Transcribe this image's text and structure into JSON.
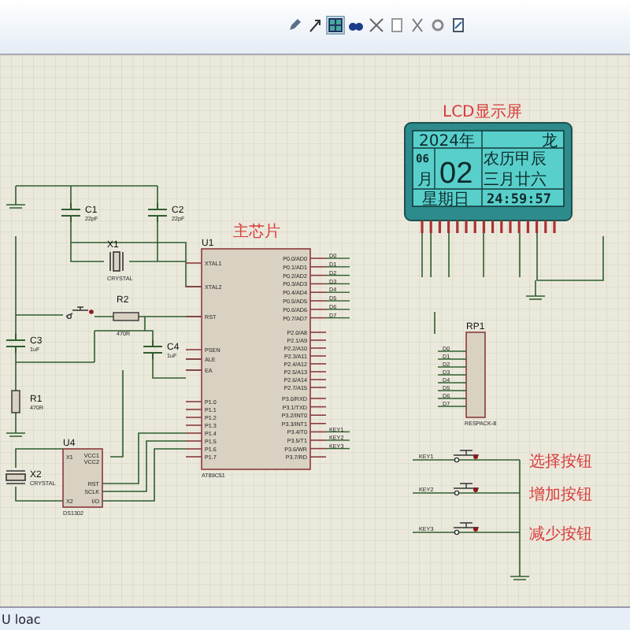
{
  "schematic": {
    "lcd": {
      "title": "LCD显示屏",
      "year": "2024年",
      "zodiac": "龙",
      "month_num": "06",
      "month_char": "月",
      "day": "02",
      "lunar_year": "农历甲辰",
      "lunar_date": "三月廿六",
      "weekday": "星期日",
      "time": "24:59:57"
    },
    "mcu": {
      "title": "主芯片",
      "ref": "U1",
      "part": "AT89C51",
      "left_pins": [
        "XTAL1",
        "XTAL2",
        "RST",
        "PSEN",
        "ALE",
        "EA",
        "P1.0",
        "P1.1",
        "P1.2",
        "P1.3",
        "P1.4",
        "P1.5",
        "P1.6",
        "P1.7"
      ],
      "right_pins": [
        "P0.0/AD0",
        "P0.1/AD1",
        "P0.2/AD2",
        "P0.3/AD3",
        "P0.4/AD4",
        "P0.5/AD5",
        "P0.6/AD6",
        "P0.7/AD7",
        "P2.0/A8",
        "P2.1/A9",
        "P2.2/A10",
        "P2.3/A11",
        "P2.4/A12",
        "P2.5/A13",
        "P2.6/A14",
        "P2.7/A15",
        "P3.0/RXD",
        "P3.1/TXD",
        "P3.2/INT0",
        "P3.3/INT1",
        "P3.4/T0",
        "P3.5/T1",
        "P3.6/WR",
        "P3.7/RD"
      ],
      "data_nets": [
        "D0",
        "D1",
        "D2",
        "D3",
        "D4",
        "D5",
        "D6",
        "D7"
      ],
      "key_nets": [
        "KEY1",
        "KEY2",
        "KEY3"
      ]
    },
    "rtc": {
      "ref": "U4",
      "part": "DS1302",
      "left_pins": [
        "X1",
        "X2"
      ],
      "right_pins": [
        "VCC1",
        "VCC2",
        "RST",
        "SCLK",
        "I/O"
      ]
    },
    "components": [
      {
        "kind": "capacitor",
        "ref": "C1",
        "value": "22pF"
      },
      {
        "kind": "capacitor",
        "ref": "C2",
        "value": "22pF"
      },
      {
        "kind": "crystal",
        "ref": "X1",
        "value": "CRYSTAL"
      },
      {
        "kind": "resistor",
        "ref": "R2",
        "value": "470R"
      },
      {
        "kind": "capacitor",
        "ref": "C3",
        "value": "1uF"
      },
      {
        "kind": "capacitor",
        "ref": "C4",
        "value": "1uF"
      },
      {
        "kind": "resistor",
        "ref": "R1",
        "value": "470R"
      },
      {
        "kind": "crystal",
        "ref": "X2",
        "value": "CRYSTAL"
      }
    ],
    "resistor_pack": {
      "ref": "RP1",
      "part": "RESPACK-8",
      "nets": [
        "D0",
        "D1",
        "D2",
        "D3",
        "D4",
        "D5",
        "D6",
        "D7"
      ]
    },
    "buttons": [
      {
        "net": "KEY1",
        "label": "选择按钮"
      },
      {
        "net": "KEY2",
        "label": "增加按钮"
      },
      {
        "net": "KEY3",
        "label": "减少按钮"
      }
    ]
  },
  "status_bar": "U loac"
}
